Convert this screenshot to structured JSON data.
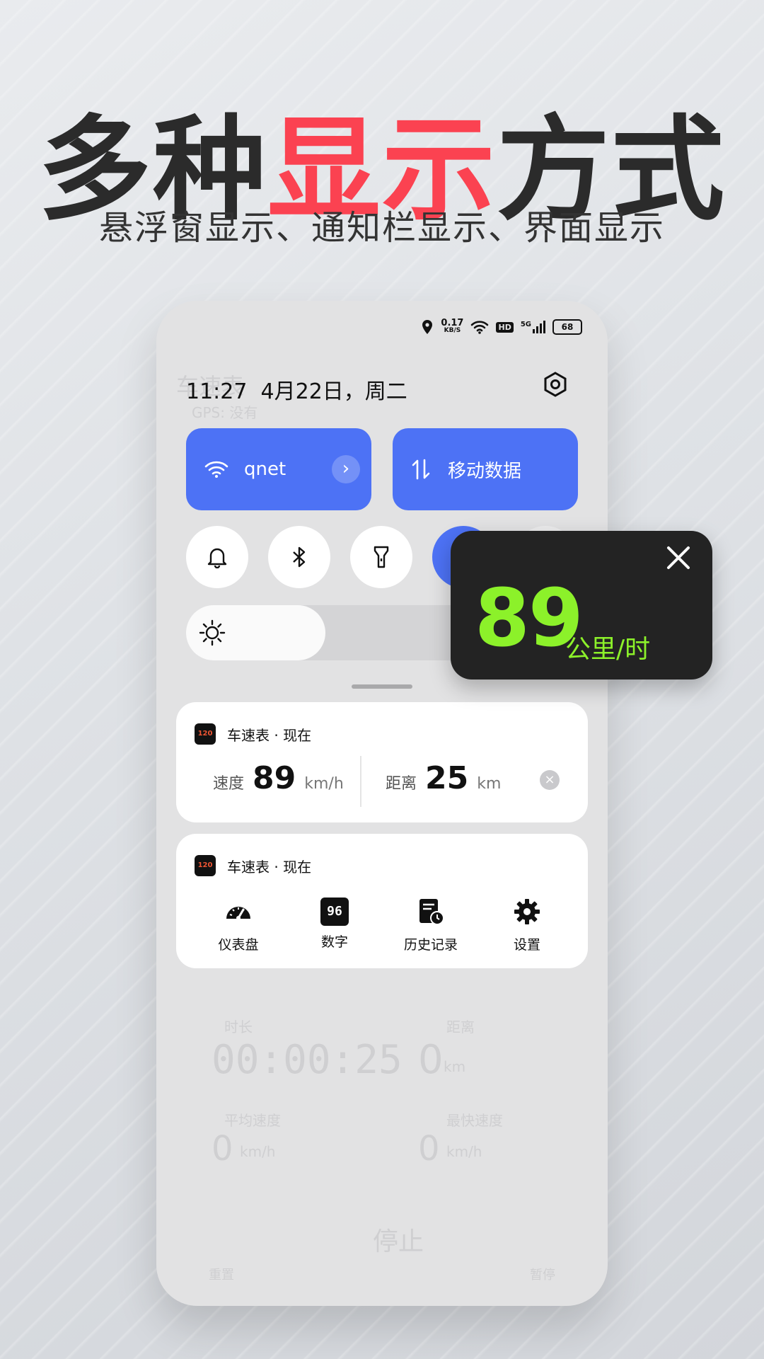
{
  "headline": {
    "part1": "多种",
    "accent": "显示",
    "part3": "方式"
  },
  "subline": "悬浮窗显示、通知栏显示、界面显示",
  "status_bar": {
    "net_speed_value": "0.17",
    "net_speed_unit": "KB/S",
    "hd": "HD",
    "network": "5G",
    "battery": "68"
  },
  "background_app": {
    "title": "车速表",
    "gps": "GPS: 没有",
    "labels": [
      "时长",
      "距离",
      "平均速度",
      "最快速度"
    ],
    "duration": "00:00:25",
    "distance": "0",
    "distance_unit": "km",
    "avg": "0",
    "max": "0",
    "speed_unit": "km/h",
    "reset": "重置",
    "stop": "停止",
    "pause": "暂停"
  },
  "quick_panel": {
    "time": "11:27",
    "date": "4月22日，周二",
    "wifi_tile": {
      "label": "qnet"
    },
    "data_tile": {
      "label": "移动数据"
    },
    "toggles": [
      "bell-icon",
      "bluetooth-icon",
      "flashlight-icon",
      "location-icon",
      "airplane-icon"
    ]
  },
  "notification_speed": {
    "app": "车速表",
    "time": "现在",
    "speed_label": "速度",
    "speed_value": "89",
    "speed_unit": "km/h",
    "distance_label": "距离",
    "distance_value": "25",
    "distance_unit": "km"
  },
  "notification_shortcuts": {
    "app": "车速表",
    "time": "现在",
    "items": [
      {
        "label": "仪表盘",
        "icon": "dashboard-icon"
      },
      {
        "label": "数字",
        "icon": "digital-display-icon",
        "icon_text": "96"
      },
      {
        "label": "历史记录",
        "icon": "history-icon"
      },
      {
        "label": "设置",
        "icon": "gear-icon"
      }
    ]
  },
  "floating_window": {
    "speed": "89",
    "unit": "公里/时"
  },
  "colors": {
    "accent_red": "#fb4251",
    "tile_blue": "#4d72f5",
    "speed_green": "#8cf12a",
    "float_bg": "#232323"
  }
}
